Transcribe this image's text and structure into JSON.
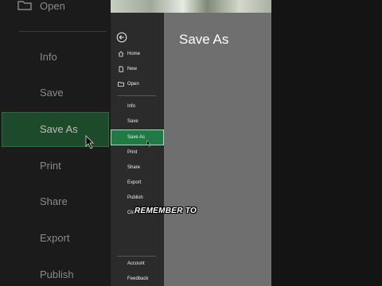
{
  "background_menu": {
    "open": "Open",
    "info": "Info",
    "save": "Save",
    "save_as": "Save As",
    "print": "Print",
    "share": "Share",
    "export": "Export",
    "publish": "Publish"
  },
  "sidebar": {
    "home": "Home",
    "new": "New",
    "open": "Open",
    "info": "Info",
    "save": "Save",
    "save_as": "Save As",
    "print": "Print",
    "share": "Share",
    "export": "Export",
    "publish": "Publish",
    "close": "Close",
    "account": "Account",
    "feedback": "Feedback"
  },
  "main": {
    "title": "Save As"
  },
  "caption": "REMEMBER TO",
  "colors": {
    "accent": "#1f7a45",
    "sidebar_bg": "#2b2b2b",
    "main_bg": "#6f6f6f"
  }
}
